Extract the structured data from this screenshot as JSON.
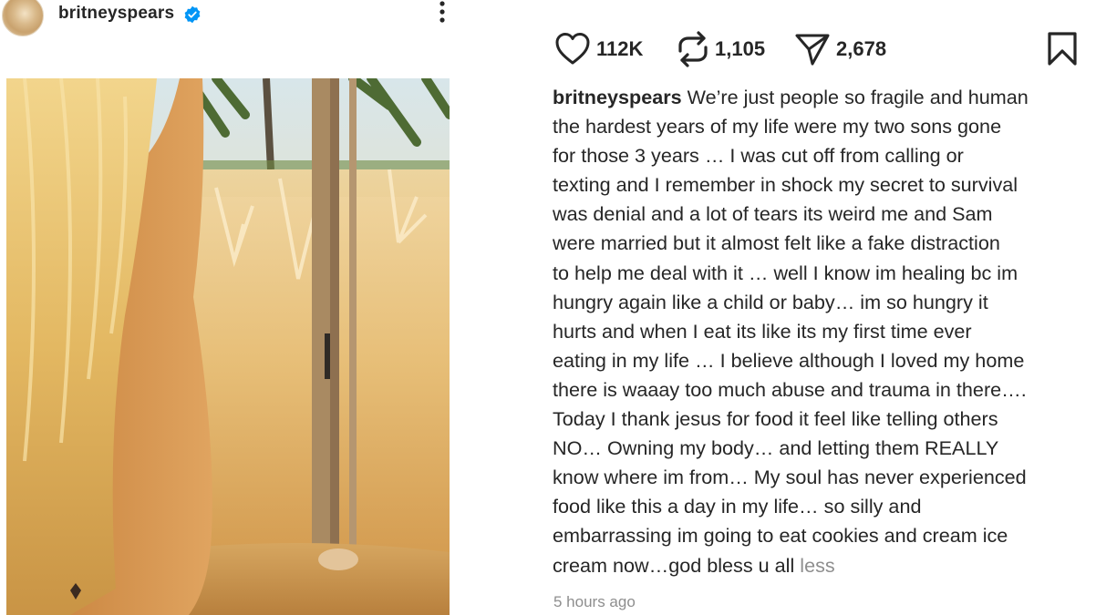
{
  "post": {
    "username": "britneyspears",
    "verified": true,
    "more_icon": "more-vertical-icon",
    "image_alt": "Photo"
  },
  "actions": {
    "likes": "112K",
    "reposts": "1,105",
    "shares": "2,678",
    "like_icon": "heart-icon",
    "repost_icon": "repost-icon",
    "share_icon": "send-icon",
    "save_icon": "bookmark-icon"
  },
  "caption": {
    "username": "britneyspears",
    "lines": [
      "We’re just people so fragile and human",
      "the hardest years of my life were my two sons gone",
      "for those 3 years … I was cut off from calling or",
      "texting and I remember in shock my secret to survival",
      "was denial and a lot of tears its weird me and Sam",
      "were married but it almost felt like a fake distraction",
      "to help me deal with it … well I know im healing bc im",
      "hungry again like a child or baby… im so hungry it",
      "hurts and when I eat its like its my first time ever",
      "eating in my life … I believe although I loved my home",
      "there is waaay too much abuse and trauma in there….",
      "Today I thank jesus for food it feel like telling others",
      "NO… Owning my  body… and letting them REALLY",
      "know where im from… My soul has never experienced",
      "food like this a day in my life… so silly and",
      "embarrassing im going to eat cookies and cream ice",
      "cream now…god bless u all"
    ],
    "less_label": "less",
    "timestamp": "5 hours ago"
  },
  "colors": {
    "text": "#262626",
    "muted": "#8e8e8e",
    "verified": "#0095f6"
  }
}
